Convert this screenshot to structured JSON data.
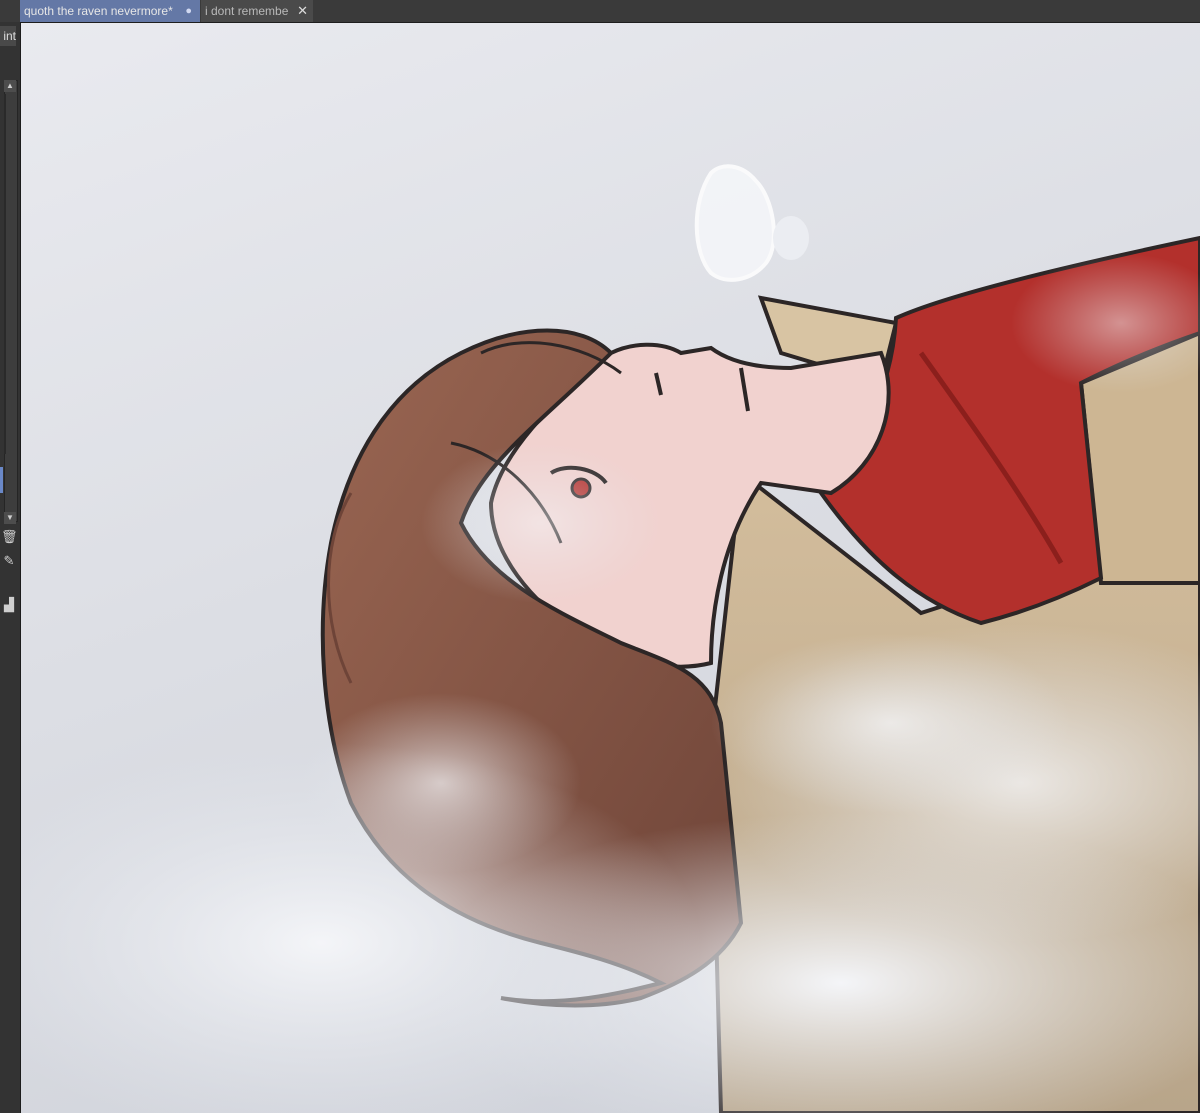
{
  "tabs": [
    {
      "label": "quoth the raven nevermore*",
      "modified_marker": "●",
      "active": true
    },
    {
      "label": "i dont remembe",
      "close_icon": "close-icon",
      "active": false
    }
  ],
  "left_panel": {
    "paint_label": "int",
    "scroll_up": "▲",
    "scroll_down": "▼",
    "icons": [
      "trash-icon",
      "pen-icon",
      "lock-icon"
    ]
  },
  "canvas": {
    "content": "illustration",
    "colors": {
      "background": "#dfe1e7",
      "hair": "#8a5a48",
      "skin": "#f1d2cf",
      "scarf": "#b3302c",
      "coat": "#cdb693",
      "snow": "#eef0f5",
      "outline": "#2c2626"
    }
  }
}
